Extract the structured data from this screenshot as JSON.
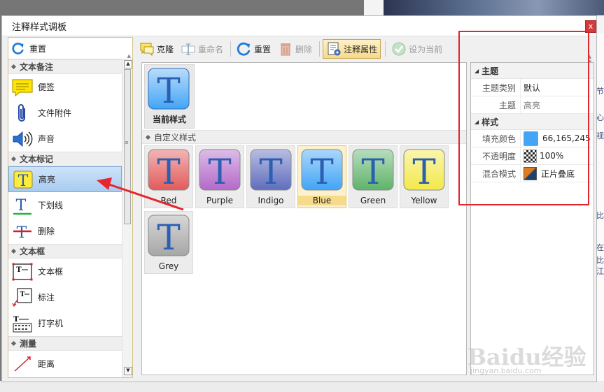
{
  "window": {
    "title": "注释样式调板",
    "close_glyph": "x"
  },
  "left_panel": {
    "reset_label": "重置",
    "categories": [
      {
        "label": "文本备注",
        "items": [
          {
            "label": "便签",
            "icon": "sticky-note-icon"
          },
          {
            "label": "文件附件",
            "icon": "paperclip-icon"
          },
          {
            "label": "声音",
            "icon": "speaker-icon"
          }
        ]
      },
      {
        "label": "文本标记",
        "items": [
          {
            "label": "高亮",
            "icon": "highlight-t-icon",
            "selected": true
          },
          {
            "label": "下划线",
            "icon": "underline-t-icon"
          },
          {
            "label": "删除",
            "icon": "strikeout-t-icon"
          }
        ]
      },
      {
        "label": "文本框",
        "items": [
          {
            "label": "文本框",
            "icon": "textbox-icon"
          },
          {
            "label": "标注",
            "icon": "callout-icon"
          },
          {
            "label": "打字机",
            "icon": "typewriter-icon"
          }
        ]
      },
      {
        "label": "测量",
        "items": [
          {
            "label": "距离",
            "icon": "distance-icon"
          }
        ]
      }
    ]
  },
  "toolbar": {
    "clone_label": "克隆",
    "rename_label": "重命名",
    "reset_label": "重置",
    "delete_label": "删除",
    "props_label": "注释属性",
    "set_current_label": "设为当前"
  },
  "styles": {
    "current_label": "当前样式",
    "custom_header": "自定义样式",
    "letter": "T",
    "items": [
      {
        "label": "Red",
        "color": "#e25a5a"
      },
      {
        "label": "Purple",
        "color": "#b36ac9"
      },
      {
        "label": "Indigo",
        "color": "#5f6dbd"
      },
      {
        "label": "Blue",
        "color": "#42a5f5",
        "selected": true
      },
      {
        "label": "Green",
        "color": "#5fb36a"
      },
      {
        "label": "Yellow",
        "color": "#f3e84a"
      },
      {
        "label": "Grey",
        "color": "#a6a6a6"
      }
    ]
  },
  "properties": {
    "theme_header": "主题",
    "theme_type_label": "主题类别",
    "theme_type_value": "默认",
    "theme_label": "主题",
    "theme_value": "高亮",
    "style_header": "样式",
    "fill_label": "填充颜色",
    "fill_value": "66,165,245",
    "fill_color": "#42a5f5",
    "opacity_label": "不透明度",
    "opacity_value": "100%",
    "blend_label": "混合模式",
    "blend_value": "正片叠底"
  },
  "watermark": {
    "brand": "Baidu经验",
    "url": "jingyan.baidu.com"
  },
  "background_edge": {
    "lines": [
      "节",
      "心",
      "视",
      "比",
      "在",
      "比",
      "江"
    ]
  }
}
